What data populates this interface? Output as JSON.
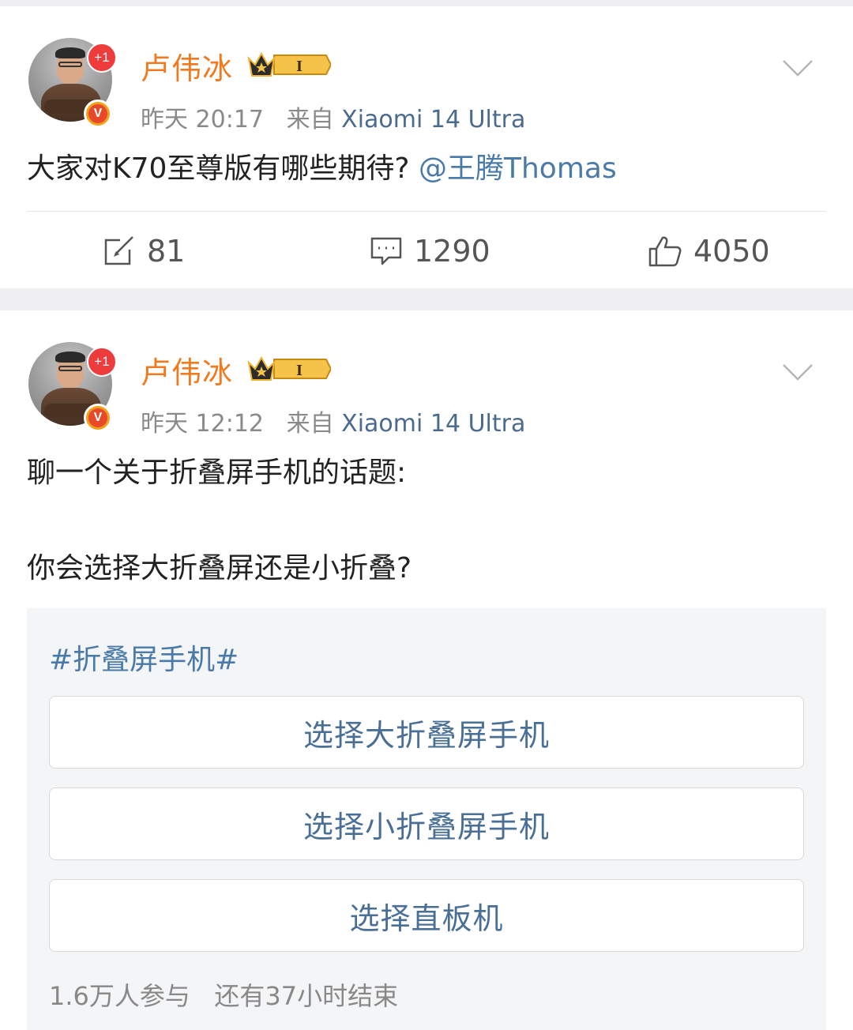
{
  "posts": [
    {
      "username": "卢伟冰",
      "plus_badge": "+1",
      "verified_badge": "V",
      "vip_level": "I",
      "time": "昨天 20:17",
      "source_prefix": "来自",
      "source_device": "Xiaomi 14 Ultra",
      "text": "大家对K70至尊版有哪些期待?",
      "mention": "@王腾Thomas",
      "reposts": "81",
      "comments": "1290",
      "likes": "4050"
    },
    {
      "username": "卢伟冰",
      "plus_badge": "+1",
      "verified_badge": "V",
      "vip_level": "I",
      "time": "昨天 12:12",
      "source_prefix": "来自",
      "source_device": "Xiaomi 14 Ultra",
      "text_line1": "聊一个关于折叠屏手机的话题:",
      "text_line2": "你会选择大折叠屏还是小折叠?",
      "poll": {
        "topic": "#折叠屏手机#",
        "options": [
          "选择大折叠屏手机",
          "选择小折叠屏手机",
          "选择直板机"
        ],
        "participants": "1.6万人参与",
        "remaining": "还有37小时结束"
      }
    }
  ],
  "icons": {
    "repost": "repost-icon",
    "comment": "comment-icon",
    "like": "like-icon",
    "more": "chevron-down-icon"
  },
  "colors": {
    "username": "#f07a1f",
    "link": "#4a7aa8",
    "meta": "#8a8a8a",
    "separator": "#f0f0f2"
  }
}
